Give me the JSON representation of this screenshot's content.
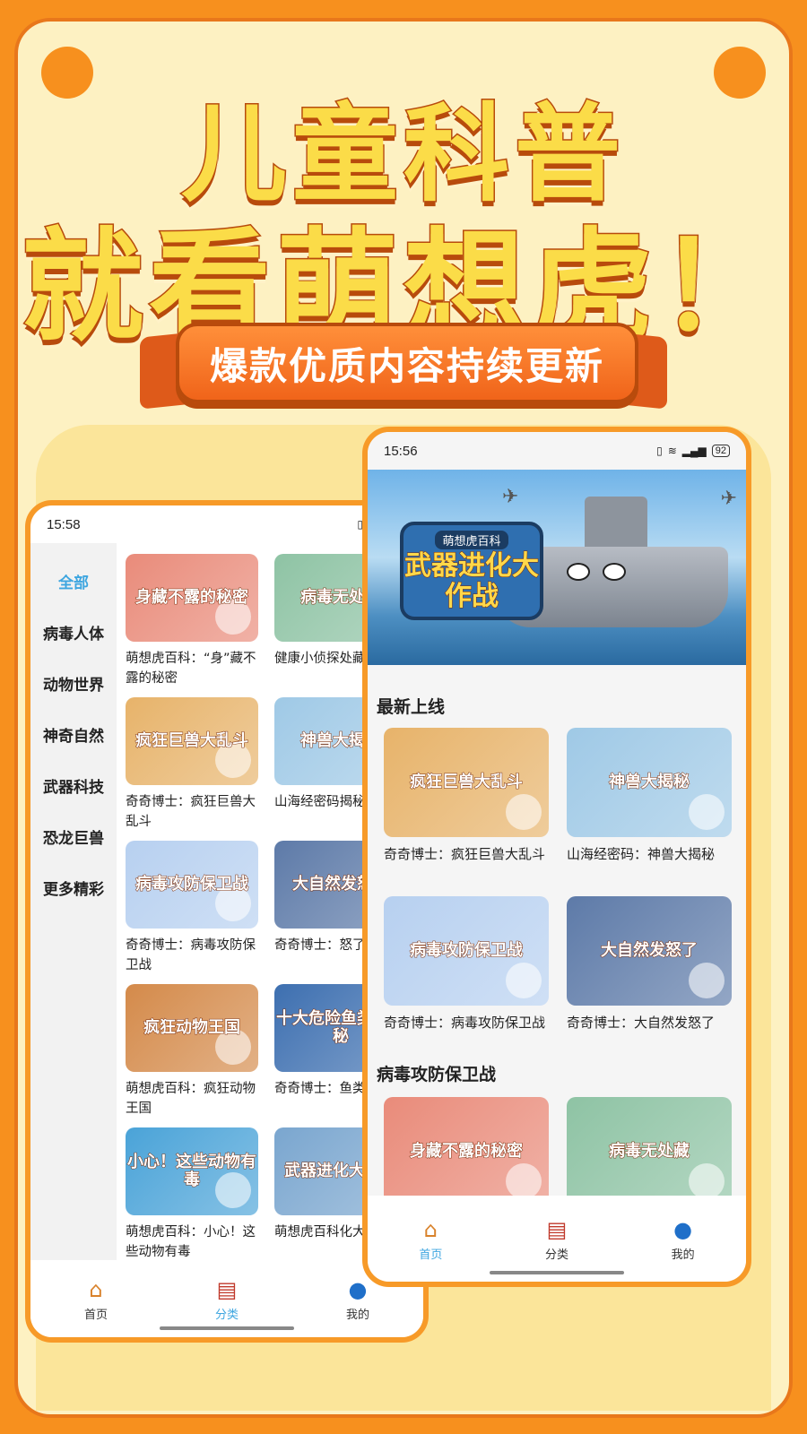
{
  "promo": {
    "headline_1": "儿童科普",
    "headline_2": "就看萌想虎！",
    "ribbon": "爆款优质内容持续更新"
  },
  "left_phone": {
    "status_time": "15:58",
    "sidebar": [
      "全部",
      "病毒人体",
      "动物世界",
      "神奇自然",
      "武器科技",
      "恐龙巨兽",
      "更多精彩"
    ],
    "cards": [
      {
        "title": "萌想虎百科：“身”藏不露的秘密",
        "thumb_text": "身藏不露的秘密",
        "color": "#e98b7a"
      },
      {
        "title": "健康小侦探处藏",
        "thumb_text": "病毒无处藏",
        "color": "#8ec3a4"
      },
      {
        "title": "奇奇博士：疯狂巨兽大乱斗",
        "thumb_text": "疯狂巨兽大乱斗",
        "color": "#e7b36a"
      },
      {
        "title": "山海经密码揭秘",
        "thumb_text": "神兽大揭秘",
        "color": "#9fc9e6"
      },
      {
        "title": "奇奇博士：病毒攻防保卫战",
        "thumb_text": "病毒攻防保卫战",
        "color": "#b7d0f0"
      },
      {
        "title": "奇奇博士：怒了",
        "thumb_text": "大自然发怒了",
        "color": "#5d7aa8"
      },
      {
        "title": "萌想虎百科：疯狂动物王国",
        "thumb_text": "疯狂动物王国",
        "color": "#d48a4a"
      },
      {
        "title": "奇奇博士：鱼类大揭秘",
        "thumb_text": "十大危险鱼类大揭秘",
        "color": "#3d6fb0"
      },
      {
        "title": "萌想虎百科：小心！这些动物有毒",
        "thumb_text": "小心！这些动物有毒",
        "color": "#4aa3d8"
      },
      {
        "title": "萌想虎百科化大作战",
        "thumb_text": "武器进化大作战",
        "color": "#7aa6cf"
      }
    ],
    "tabs": [
      "首页",
      "分类",
      "我的"
    ]
  },
  "right_phone": {
    "status_time": "15:56",
    "battery": "92",
    "banner_sub": "萌想虎百科",
    "banner_title": "武器进化大作战",
    "section_latest": "最新上线",
    "latest_cards": [
      {
        "title": "奇奇博士：疯狂巨兽大乱斗",
        "thumb_text": "疯狂巨兽大乱斗",
        "color": "#e7b36a"
      },
      {
        "title": "山海经密码：神兽大揭秘",
        "thumb_text": "神兽大揭秘",
        "color": "#9fc9e6"
      },
      {
        "title": "奇奇博士：病毒攻防保卫战",
        "thumb_text": "病毒攻防保卫战",
        "color": "#b7d0f0"
      },
      {
        "title": "奇奇博士：大自然发怒了",
        "thumb_text": "大自然发怒了",
        "color": "#5d7aa8"
      }
    ],
    "section_virus": "病毒攻防保卫战",
    "virus_cards": [
      {
        "thumb_text": "身藏不露的秘密",
        "color": "#e98b7a"
      },
      {
        "thumb_text": "病毒无处藏",
        "color": "#8ec3a4"
      }
    ],
    "tabs": [
      "首页",
      "分类",
      "我的"
    ]
  }
}
